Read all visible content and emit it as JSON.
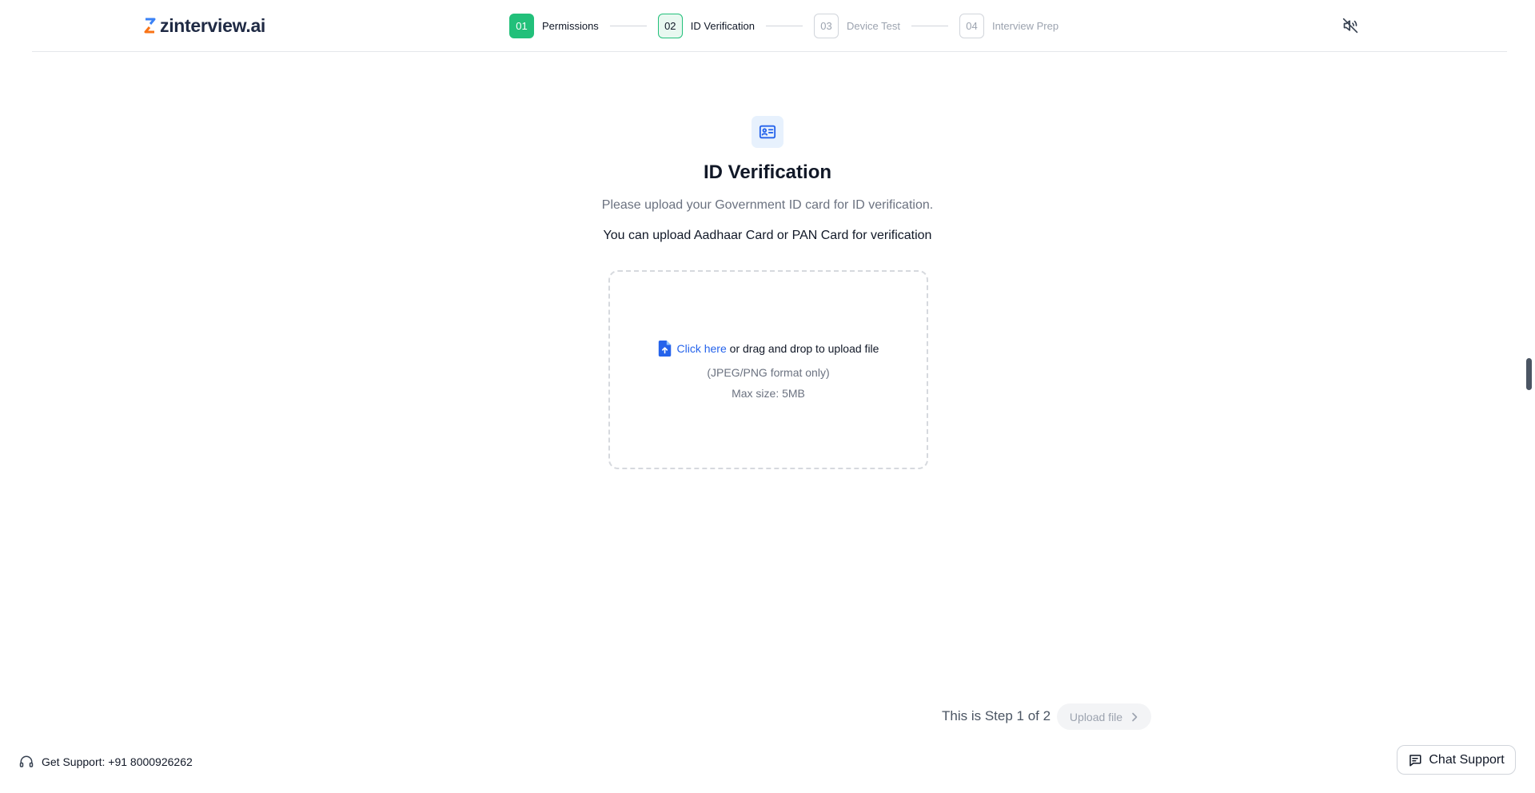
{
  "brand": {
    "name": "zinterview.ai"
  },
  "stepper": [
    {
      "number": "01",
      "label": "Permissions",
      "state": "done"
    },
    {
      "number": "02",
      "label": "ID Verification",
      "state": "active"
    },
    {
      "number": "03",
      "label": "Device Test",
      "state": "pending"
    },
    {
      "number": "04",
      "label": "Interview Prep",
      "state": "pending"
    }
  ],
  "main": {
    "title": "ID Verification",
    "subtitle": "Please upload your Government ID card for ID verification.",
    "note": "You can upload Aadhaar Card or PAN Card for verification",
    "dropzone": {
      "link_text": "Click here",
      "rest_text": " or drag and drop to upload file",
      "format_hint": "(JPEG/PNG format only)",
      "size_hint": "Max size: 5MB"
    },
    "progress_text": "This is Step 1 of 2",
    "upload_button": "Upload file"
  },
  "footer": {
    "support_text": "Get Support: +91 8000926262",
    "chat_button": "Chat Support"
  },
  "colors": {
    "accent_green": "#22c07a",
    "link_blue": "#2563eb",
    "icon_bg": "#e7f1fd"
  },
  "icons": {
    "mute": "volume-off-icon",
    "id_card": "id-card-icon",
    "file_upload": "file-upload-icon",
    "headset": "headset-icon",
    "chat": "chat-icon",
    "chevron": "chevron-right-icon"
  }
}
